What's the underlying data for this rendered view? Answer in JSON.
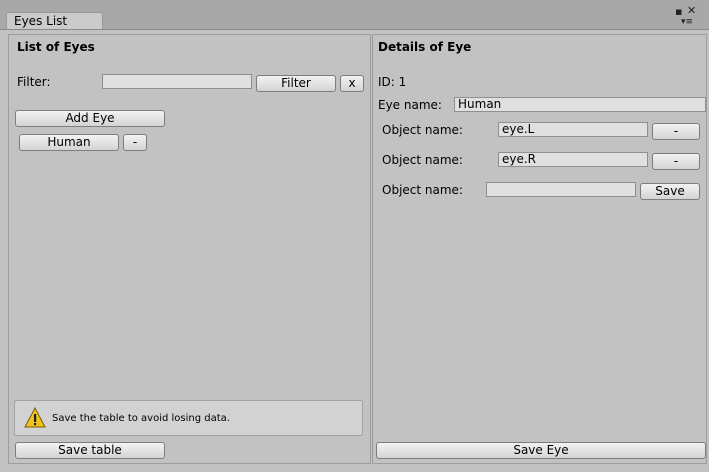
{
  "window": {
    "tab_title": "Eyes List"
  },
  "left": {
    "title": "List of Eyes",
    "filter_label": "Filter:",
    "filter_value": "",
    "filter_button": "Filter",
    "clear_button": "x",
    "add_button": "Add Eye",
    "items": [
      {
        "label": "Human",
        "remove": "-"
      }
    ],
    "help_text": "Save the table to avoid losing data.",
    "save_button": "Save table"
  },
  "right": {
    "title": "Details of Eye",
    "id_text": "ID: 1",
    "eye_name_label": "Eye name:",
    "eye_name_value": "Human",
    "objects": [
      {
        "label": "Object name:",
        "value": "eye.L",
        "button": "-"
      },
      {
        "label": "Object name:",
        "value": "eye.R",
        "button": "-"
      },
      {
        "label": "Object name:",
        "value": "",
        "button": "Save"
      }
    ],
    "save_button": "Save Eye"
  }
}
